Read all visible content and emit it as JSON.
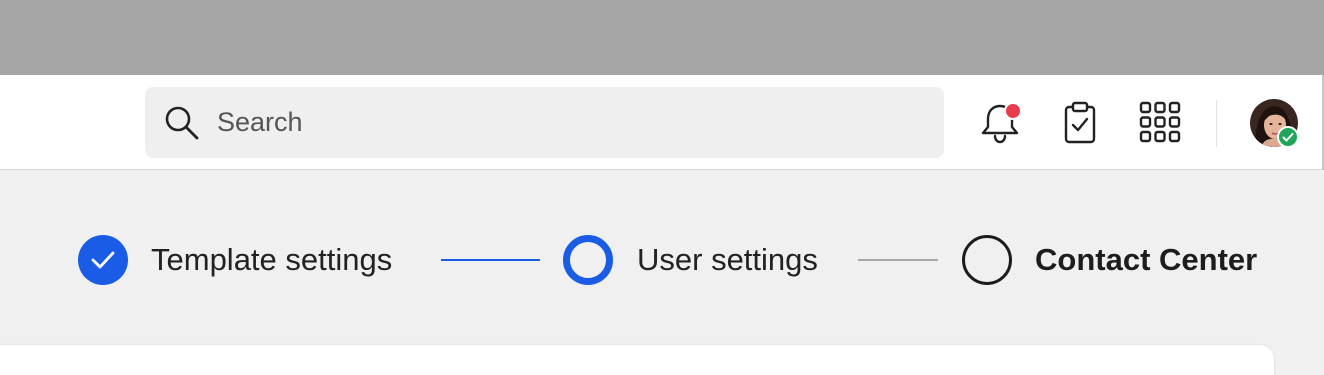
{
  "header": {
    "search": {
      "placeholder": "Search",
      "value": ""
    },
    "icons": {
      "search": "search-icon",
      "notifications": "bell-icon",
      "tasks": "clipboard-check-icon",
      "apps": "grid-icon",
      "user": "avatar"
    },
    "notification_dot_color": "#e83b4c",
    "presence_status": "online",
    "presence_color": "#1ea65a"
  },
  "stepper": {
    "accent_color": "#1a5ce5",
    "steps": [
      {
        "label": "Template settings",
        "state": "completed"
      },
      {
        "label": "User settings",
        "state": "current"
      },
      {
        "label": "Contact Center",
        "state": "upcoming"
      }
    ]
  }
}
